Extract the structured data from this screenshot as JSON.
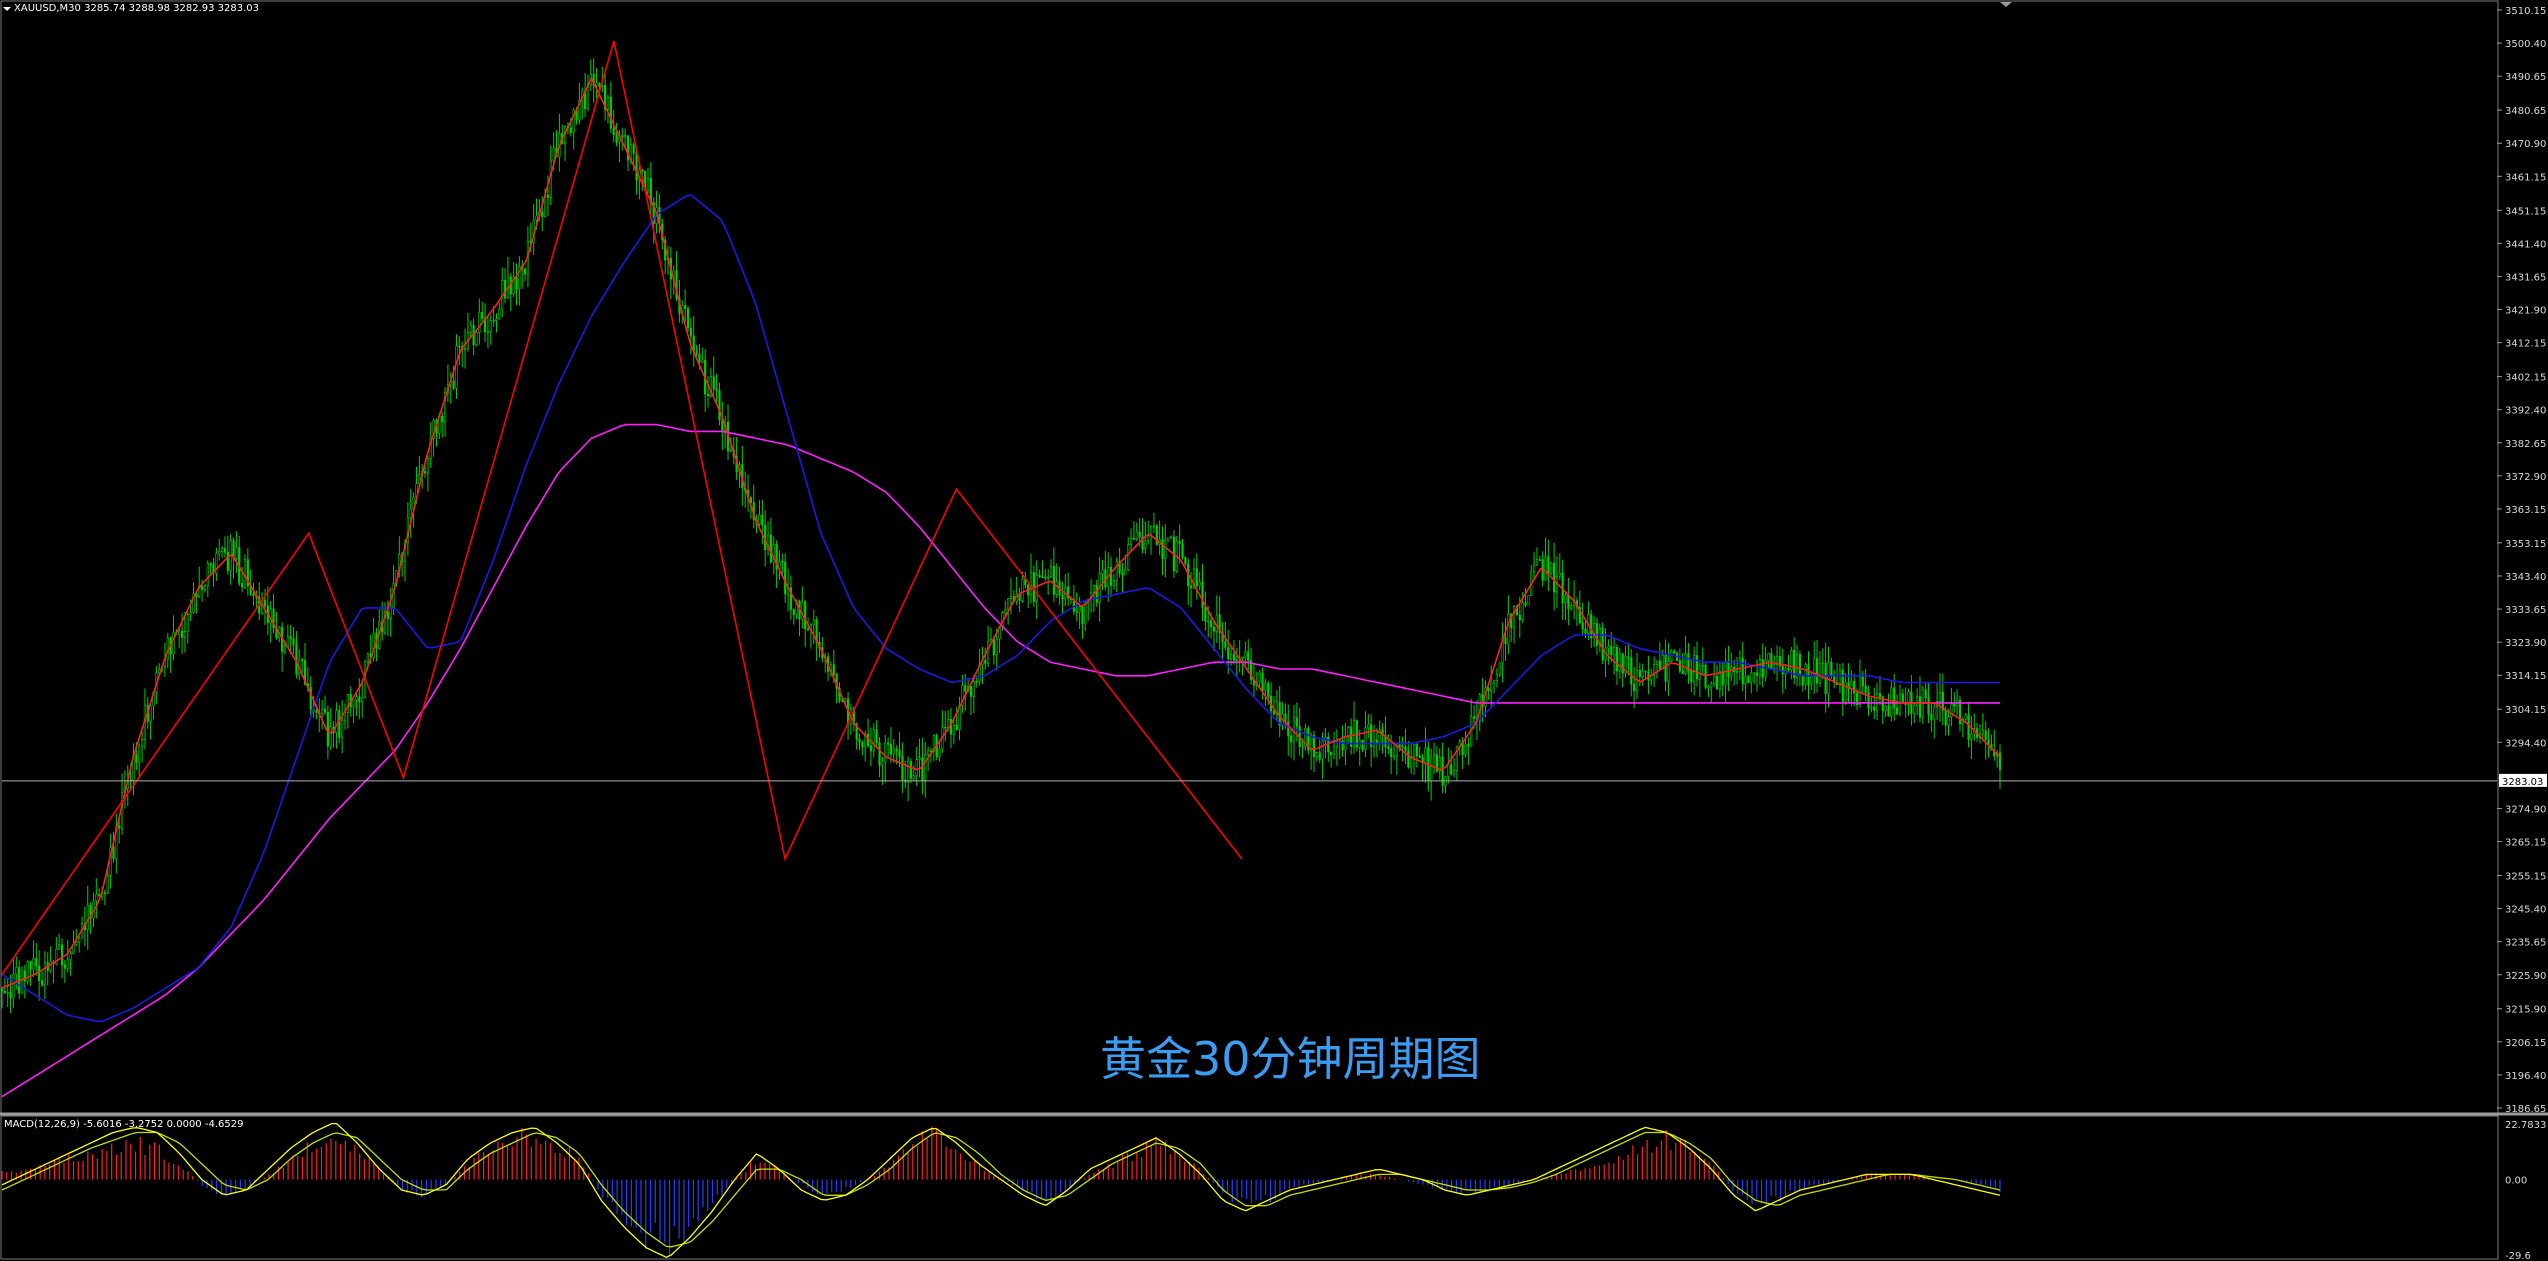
{
  "header": {
    "symbol_line": "XAUUSD,M30  3285.74 3288.98 3282.93 3283.03"
  },
  "overlay_title": "黄金30分钟周期图",
  "current_price_label": "3283.03",
  "macd_header": "MACD(12,26,9) -5.6016 -3.2752 0.0000 -4.6529",
  "colors": {
    "background": "#000000",
    "candle": "#00d000",
    "ma_fast": "#ff2020",
    "ma_mid": "#1a1ae6",
    "ma_slow": "#ff20ff",
    "zigzag": "#ff0000",
    "macd_pos": "#ff2020",
    "macd_neg": "#2040ff",
    "macd_line": "#ffff00",
    "signal_line": "#c0e000",
    "axis_text": "#d8d8d8",
    "title": "#3a9df2"
  },
  "chart_data": [
    {
      "type": "candlestick",
      "title": "XAUUSD,M30",
      "y_ticks": [
        "3510.15",
        "3500.40",
        "3490.65",
        "3480.65",
        "3470.90",
        "3461.15",
        "3451.15",
        "3441.40",
        "3431.65",
        "3421.90",
        "3412.15",
        "3402.15",
        "3392.40",
        "3382.65",
        "3372.90",
        "3363.15",
        "3353.15",
        "3343.40",
        "3333.65",
        "3323.90",
        "3314.15",
        "3304.15",
        "3294.40",
        "3283.03",
        "3274.90",
        "3265.15",
        "3255.15",
        "3245.40",
        "3235.65",
        "3225.90",
        "3215.90",
        "3206.15",
        "3196.40",
        "3186.65"
      ],
      "ylim": [
        3186.65,
        3510.15
      ],
      "zigzag": [
        {
          "x": 0,
          "y": 3226
        },
        {
          "x": 172,
          "y": 3356
        },
        {
          "x": 225,
          "y": 3284
        },
        {
          "x": 343,
          "y": 3501
        },
        {
          "x": 439,
          "y": 3260
        },
        {
          "x": 535,
          "y": 3369
        },
        {
          "x": 695,
          "y": 3260
        }
      ],
      "ma_fast_trend": [
        3222,
        3226,
        3232,
        3248,
        3290,
        3320,
        3340,
        3350,
        3334,
        3318,
        3296,
        3312,
        3340,
        3380,
        3410,
        3422,
        3436,
        3470,
        3490,
        3470,
        3450,
        3412,
        3390,
        3360,
        3340,
        3322,
        3300,
        3290,
        3286,
        3300,
        3320,
        3338,
        3342,
        3334,
        3346,
        3356,
        3348,
        3330,
        3316,
        3302,
        3292,
        3296,
        3298,
        3290,
        3286,
        3300,
        3330,
        3346,
        3336,
        3320,
        3312,
        3318,
        3314,
        3316,
        3318,
        3316,
        3312,
        3308,
        3306,
        3306,
        3300,
        3290
      ],
      "ma_mid_trend": [
        3226,
        3220,
        3214,
        3212,
        3216,
        3222,
        3228,
        3240,
        3262,
        3290,
        3318,
        3334,
        3334,
        3322,
        3324,
        3348,
        3376,
        3400,
        3420,
        3436,
        3450,
        3456,
        3448,
        3424,
        3390,
        3356,
        3334,
        3322,
        3316,
        3312,
        3314,
        3320,
        3330,
        3336,
        3338,
        3340,
        3334,
        3322,
        3310,
        3300,
        3296,
        3294,
        3294,
        3294,
        3296,
        3300,
        3310,
        3320,
        3326,
        3326,
        3322,
        3320,
        3318,
        3318,
        3316,
        3314,
        3314,
        3314,
        3312,
        3312,
        3312,
        3312
      ],
      "ma_slow_trend": [
        3190,
        3196,
        3202,
        3208,
        3214,
        3220,
        3228,
        3238,
        3248,
        3260,
        3272,
        3282,
        3292,
        3306,
        3322,
        3340,
        3358,
        3374,
        3384,
        3388,
        3388,
        3386,
        3386,
        3384,
        3382,
        3378,
        3374,
        3368,
        3358,
        3346,
        3334,
        3324,
        3318,
        3316,
        3314,
        3314,
        3316,
        3318,
        3318,
        3316,
        3316,
        3314,
        3312,
        3310,
        3308,
        3306,
        3306,
        3306,
        3306,
        3306,
        3306,
        3306,
        3306,
        3306,
        3306,
        3306,
        3306,
        3306,
        3306,
        3306,
        3306,
        3306
      ],
      "candle_seed": 20250601,
      "candle_count": 700
    },
    {
      "type": "macd",
      "title": "MACD(12,26,9)",
      "ylim": [
        -29.6,
        22.7833
      ],
      "y_ticks": [
        "22.7833",
        "0.00",
        "-29.6"
      ],
      "histogram_trend": [
        3,
        4,
        6,
        8,
        10,
        12,
        14,
        12,
        6,
        -2,
        -6,
        -4,
        2,
        8,
        14,
        18,
        12,
        4,
        -4,
        -6,
        -2,
        6,
        12,
        16,
        18,
        14,
        8,
        -6,
        -14,
        -22,
        -26,
        -20,
        -10,
        0,
        8,
        4,
        -2,
        -6,
        -4,
        0,
        6,
        14,
        18,
        12,
        6,
        0,
        -4,
        -8,
        -4,
        2,
        6,
        10,
        14,
        10,
        4,
        -6,
        -10,
        -8,
        -4,
        -2,
        0,
        2,
        2,
        0,
        -2,
        -4,
        -6,
        -4,
        -2,
        0,
        2,
        4,
        6,
        10,
        14,
        16,
        12,
        6,
        -4,
        -10,
        -8,
        -4,
        -2,
        0,
        2,
        2,
        2,
        0,
        0,
        -2,
        -4
      ],
      "macd_line_trend": [
        -2,
        2,
        6,
        10,
        14,
        18,
        20,
        18,
        10,
        0,
        -6,
        -4,
        4,
        12,
        18,
        22,
        14,
        4,
        -4,
        -6,
        -2,
        8,
        14,
        18,
        20,
        14,
        6,
        -8,
        -18,
        -26,
        -30,
        -22,
        -12,
        0,
        10,
        4,
        -4,
        -8,
        -6,
        0,
        8,
        16,
        20,
        14,
        6,
        0,
        -6,
        -10,
        -4,
        4,
        8,
        12,
        16,
        10,
        2,
        -8,
        -12,
        -8,
        -4,
        -2,
        0,
        2,
        4,
        2,
        0,
        -4,
        -6,
        -4,
        -2,
        0,
        4,
        8,
        12,
        16,
        20,
        18,
        12,
        4,
        -6,
        -12,
        -8,
        -4,
        -2,
        0,
        2,
        2,
        2,
        0,
        -2,
        -4,
        -6
      ],
      "signal_line_trend": [
        -4,
        0,
        4,
        8,
        12,
        15,
        18,
        18,
        14,
        6,
        -2,
        -4,
        0,
        8,
        14,
        18,
        16,
        8,
        0,
        -4,
        -4,
        4,
        10,
        14,
        18,
        16,
        10,
        -2,
        -12,
        -20,
        -26,
        -24,
        -16,
        -6,
        4,
        4,
        0,
        -6,
        -6,
        -2,
        4,
        12,
        18,
        16,
        10,
        2,
        -4,
        -8,
        -6,
        0,
        6,
        10,
        14,
        12,
        6,
        -4,
        -10,
        -10,
        -6,
        -4,
        -2,
        0,
        2,
        2,
        0,
        -2,
        -4,
        -4,
        -3,
        -1,
        2,
        6,
        10,
        14,
        18,
        18,
        14,
        8,
        -2,
        -8,
        -10,
        -6,
        -4,
        -2,
        0,
        2,
        2,
        1,
        0,
        -2,
        -4
      ]
    }
  ]
}
